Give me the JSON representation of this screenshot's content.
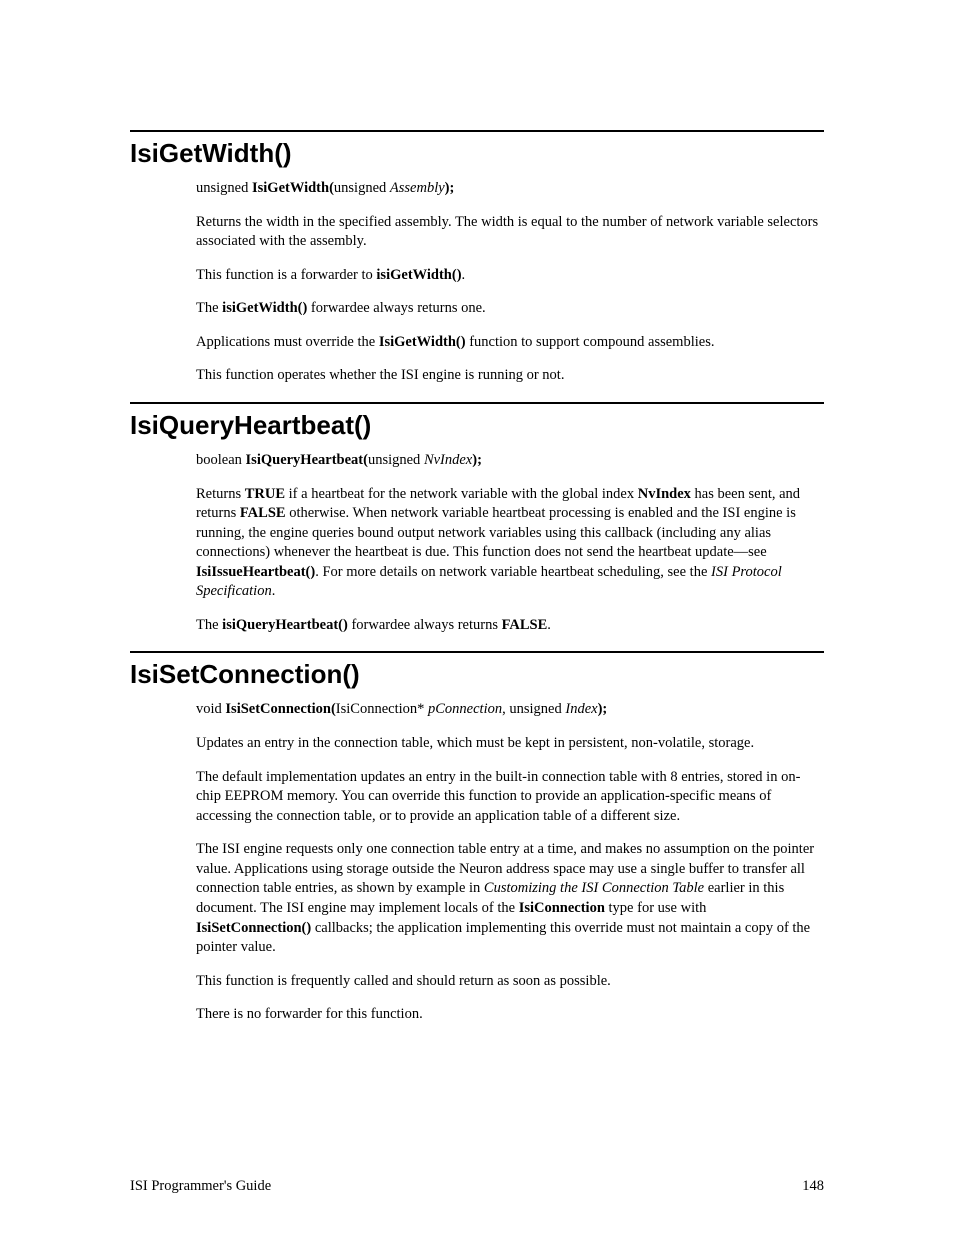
{
  "sec1": {
    "title": "IsiGetWidth()",
    "sig": {
      "pre": "unsigned ",
      "fn": "IsiGetWidth(",
      "argpre": "unsigned ",
      "arg": "Assembly",
      "post": ");"
    },
    "p1": "Returns the width in the specified assembly.  The width is equal to the number of network variable selectors associated with the assembly.",
    "p2a": "This function is a forwarder to ",
    "p2b": "isiGetWidth()",
    "p2c": ".",
    "p3a": "The ",
    "p3b": "isiGetWidth()",
    "p3c": " forwardee always returns one.",
    "p4a": "Applications must override the ",
    "p4b": "IsiGetWidth()",
    "p4c": " function to support compound assemblies.",
    "p5": "This function operates whether the ISI engine is running or not."
  },
  "sec2": {
    "title": "IsiQueryHeartbeat()",
    "sig": {
      "pre": "boolean ",
      "fn": "IsiQueryHeartbeat(",
      "argpre": "unsigned ",
      "arg": "NvIndex",
      "post": ");"
    },
    "p1a": "Returns ",
    "p1b": "TRUE",
    "p1c": " if a heartbeat for the network variable with the global index ",
    "p1d": "NvIndex",
    "p1e": " has been sent, and returns ",
    "p1f": "FALSE",
    "p1g": " otherwise.  When network variable heartbeat processing is enabled and the ISI engine is running, the engine queries bound output network variables using this callback (including any alias connections) whenever the heartbeat is due.  This function does not send the heartbeat update—see ",
    "p1h": "IsiIssueHeartbeat()",
    "p1i": ".  For more details on network variable heartbeat scheduling, see the ",
    "p1j": "ISI Protocol Specification",
    "p1k": ".",
    "p2a": "The ",
    "p2b": "isiQueryHeartbeat()",
    "p2c": " forwardee always returns ",
    "p2d": "FALSE",
    "p2e": "."
  },
  "sec3": {
    "title": "IsiSetConnection()",
    "sig": {
      "pre": "void ",
      "fn": "IsiSetConnection(",
      "t1": "IsiConnection* ",
      "a1": "pConnection",
      "sep": ", unsigned ",
      "a2": "Index",
      "post": ");"
    },
    "p1": "Updates an entry in the connection table, which must be kept in persistent, non-volatile, storage.",
    "p2": "The default implementation updates an entry in the built-in connection table with 8 entries, stored in on-chip EEPROM memory.  You can override this function to provide an application-specific means of accessing the connection table, or to provide an application table of a different size.",
    "p3a": "The ISI engine requests only one connection table entry at a time, and makes no assumption on the pointer value.  Applications using storage outside the Neuron address space may use a single buffer to transfer all connection table entries, as shown by example in ",
    "p3b": "Customizing the ISI Connection Table",
    "p3c": " earlier in this document.  The ISI engine may implement locals of the ",
    "p3d": "IsiConnection",
    "p3e": " type for use with ",
    "p3f": "IsiSetConnection()",
    "p3g": " callbacks; the application implementing this override must not maintain a copy of the pointer value.",
    "p4": "This function is frequently called and should return as soon as possible.",
    "p5": "There is no forwarder for this function."
  },
  "footer": {
    "left": "ISI Programmer's Guide",
    "right": "148"
  }
}
